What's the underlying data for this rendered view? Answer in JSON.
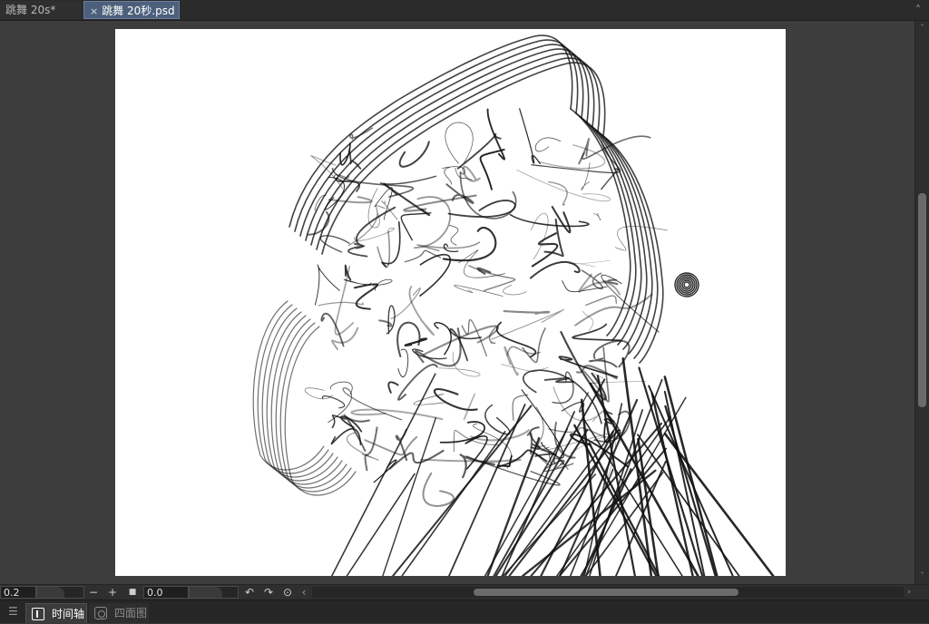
{
  "tabs": [
    {
      "label": "跳舞 20s*",
      "active": false
    },
    {
      "label": "跳舞 20秒.psd",
      "active": true,
      "close_glyph": "×"
    }
  ],
  "window_controls": {
    "scroll_up_glyph": "˄"
  },
  "canvas": {
    "background": "#ffffff"
  },
  "toolbar": {
    "zoom_value": "0.2",
    "zoom_out_glyph": "−",
    "zoom_in_glyph": "+",
    "reset_glyph": "■",
    "rotation_value": "0.0",
    "rotate_left_glyph": "↶",
    "rotate_right_glyph": "↷",
    "reset_rotation_glyph": "⊙",
    "scroll_left_glyph": "‹",
    "scroll_right_glyph": "›"
  },
  "scrollbar": {
    "up_glyph": "˄",
    "down_glyph": "˅"
  },
  "panel_tabs": [
    {
      "label": "时间轴",
      "active": true,
      "icon": "timeline-icon"
    },
    {
      "label": "四面图",
      "active": false,
      "icon": "camera-icon"
    }
  ],
  "panel_menu_glyph": "☰",
  "colors": {
    "accent": "#4c5f7b",
    "background": "#3a3a3a"
  }
}
